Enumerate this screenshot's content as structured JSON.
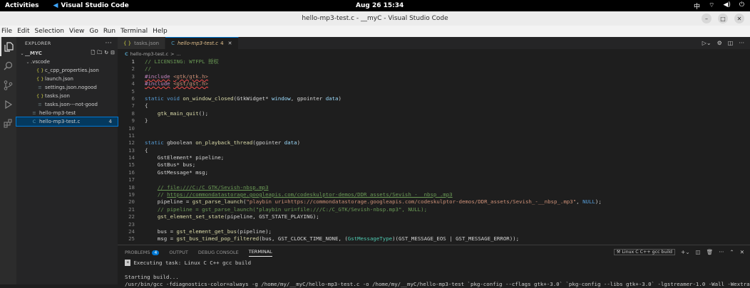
{
  "topbar": {
    "activities": "Activities",
    "app": "Visual Studio Code",
    "clock": "Aug 26  15:34",
    "tray": [
      "中",
      "wifi-icon",
      "volume-icon",
      "power-icon"
    ]
  },
  "window": {
    "title": "hello-mp3-test.c - __myC - Visual Studio Code"
  },
  "menu": [
    "File",
    "Edit",
    "Selection",
    "View",
    "Go",
    "Run",
    "Terminal",
    "Help"
  ],
  "explorer": {
    "header": "EXPLORER",
    "folder": "__MYC",
    "items": [
      {
        "label": ".vscode",
        "icon": "",
        "indent": 1,
        "twist": "⌄"
      },
      {
        "label": "c_cpp_properties.json",
        "icon": "{ }",
        "indent": 2,
        "color": "#cbcb41"
      },
      {
        "label": "launch.json",
        "icon": "{ }",
        "indent": 2,
        "color": "#cbcb41"
      },
      {
        "label": "settings.json.nogood",
        "icon": "≡",
        "indent": 2,
        "color": "#6d8086"
      },
      {
        "label": "tasks.json",
        "icon": "{ }",
        "indent": 2,
        "color": "#cbcb41"
      },
      {
        "label": "tasks.json---not-good",
        "icon": "≡",
        "indent": 2,
        "color": "#6d8086"
      },
      {
        "label": "hello-mp3-test",
        "icon": "≡",
        "indent": 1,
        "color": "#6d8086"
      },
      {
        "label": "hello-mp3-test.c",
        "icon": "C",
        "indent": 1,
        "color": "#519aba",
        "badge": "4",
        "selected": true
      }
    ]
  },
  "tabs": [
    {
      "label": "tasks.json",
      "icon": "{ }",
      "active": false
    },
    {
      "label": "hello-mp3-test.c",
      "icon": "C",
      "active": true,
      "badge": "4"
    }
  ],
  "breadcrumb": {
    "icon": "C",
    "file": "hello-mp3-test.c",
    "sep": ">",
    "rest": "..."
  },
  "code_lines": [
    [
      [
        "cm",
        "// LICENSING: WTFPL 授权"
      ]
    ],
    [
      [
        "cm",
        "//"
      ]
    ],
    [
      [
        "ppk",
        "#include"
      ],
      [
        "",
        " "
      ],
      [
        "inc",
        "<gtk/gtk.h>"
      ]
    ],
    [
      [
        "ppk",
        "#include"
      ],
      [
        "",
        " "
      ],
      [
        "inc",
        "<gst/gst.h>"
      ]
    ],
    [],
    [
      [
        "k",
        "static"
      ],
      [
        "",
        " "
      ],
      [
        "k",
        "void"
      ],
      [
        "",
        " "
      ],
      [
        "f",
        "on_window_closed"
      ],
      [
        "",
        "(GtkWidget* "
      ],
      [
        "p",
        "window"
      ],
      [
        "",
        ", gpointer "
      ],
      [
        "p",
        "data"
      ],
      [
        "",
        ")"
      ]
    ],
    [
      [
        "",
        "{"
      ]
    ],
    [
      [
        "",
        "    "
      ],
      [
        "f",
        "gtk_main_quit"
      ],
      [
        "",
        "();"
      ]
    ],
    [
      [
        "",
        "}"
      ]
    ],
    [],
    [],
    [
      [
        "k",
        "static"
      ],
      [
        "",
        " gboolean "
      ],
      [
        "f",
        "on_playback_thread"
      ],
      [
        "",
        "(gpointer "
      ],
      [
        "p",
        "data"
      ],
      [
        "",
        ")"
      ]
    ],
    [
      [
        "",
        "{"
      ]
    ],
    [
      [
        "",
        "    GstElement* pipeline;"
      ]
    ],
    [
      [
        "",
        "    GstBus* bus;"
      ]
    ],
    [
      [
        "",
        "    GstMessage* msg;"
      ]
    ],
    [],
    [
      [
        "",
        "    "
      ],
      [
        "cmu",
        "// file:///C:/C_GTK/Sevish-nbsp.mp3"
      ]
    ],
    [
      [
        "",
        "    "
      ],
      [
        "cm",
        "// "
      ],
      [
        "cmu",
        "https://commondatastorage.googleapis.com/codeskulptor-demos/DDR_assets/Sevish_-__nbsp_.mp3"
      ]
    ],
    [
      [
        "",
        "    pipeline = "
      ],
      [
        "f",
        "gst_parse_launch"
      ],
      [
        "",
        "("
      ],
      [
        "s",
        "\"playbin uri=https://commondatastorage.googleapis.com/codeskulptor-demos/DDR_assets/Sevish_-__nbsp_.mp3\""
      ],
      [
        "",
        ", "
      ],
      [
        "k",
        "NULL"
      ],
      [
        "",
        ");"
      ]
    ],
    [
      [
        "",
        "    "
      ],
      [
        "cm",
        "// pipeline = gst_parse_launch(\"playbin uri=file:///C:/C_GTK/Sevish-nbsp.mp3\", NULL);"
      ]
    ],
    [
      [
        "",
        "    "
      ],
      [
        "f",
        "gst_element_set_state"
      ],
      [
        "",
        "(pipeline, GST_STATE_PLAYING);"
      ]
    ],
    [],
    [
      [
        "",
        "    bus = "
      ],
      [
        "f",
        "gst_element_get_bus"
      ],
      [
        "",
        "(pipeline);"
      ]
    ],
    [
      [
        "",
        "    msg = "
      ],
      [
        "f",
        "gst_bus_timed_pop_filtered"
      ],
      [
        "",
        "(bus, GST_CLOCK_TIME_NONE, ("
      ],
      [
        "t",
        "GstMessageType"
      ],
      [
        "",
        ")(GST_MESSAGE_EOS | GST_MESSAGE_ERROR));"
      ]
    ]
  ],
  "panel": {
    "tabs": [
      {
        "label": "PROBLEMS",
        "count": "4",
        "active": false
      },
      {
        "label": "OUTPUT",
        "active": false
      },
      {
        "label": "DEBUG CONSOLE",
        "active": false
      },
      {
        "label": "TERMINAL",
        "active": true
      }
    ],
    "task": "Linux C C++ gcc build",
    "terminal_lines": [
      "Executing task: Linux C C++ gcc build",
      "",
      "Starting build...",
      "/usr/bin/gcc -fdiagnostics-color=always -g /home/my/__myC/hello-mp3-test.c -o /home/my/__myC/hello-mp3-test `pkg-config --cflags gtk+-3.0` `pkg-config --libs gtk+-3.0` -lgstreamer-1.0 -Wall -Wextra"
    ]
  }
}
